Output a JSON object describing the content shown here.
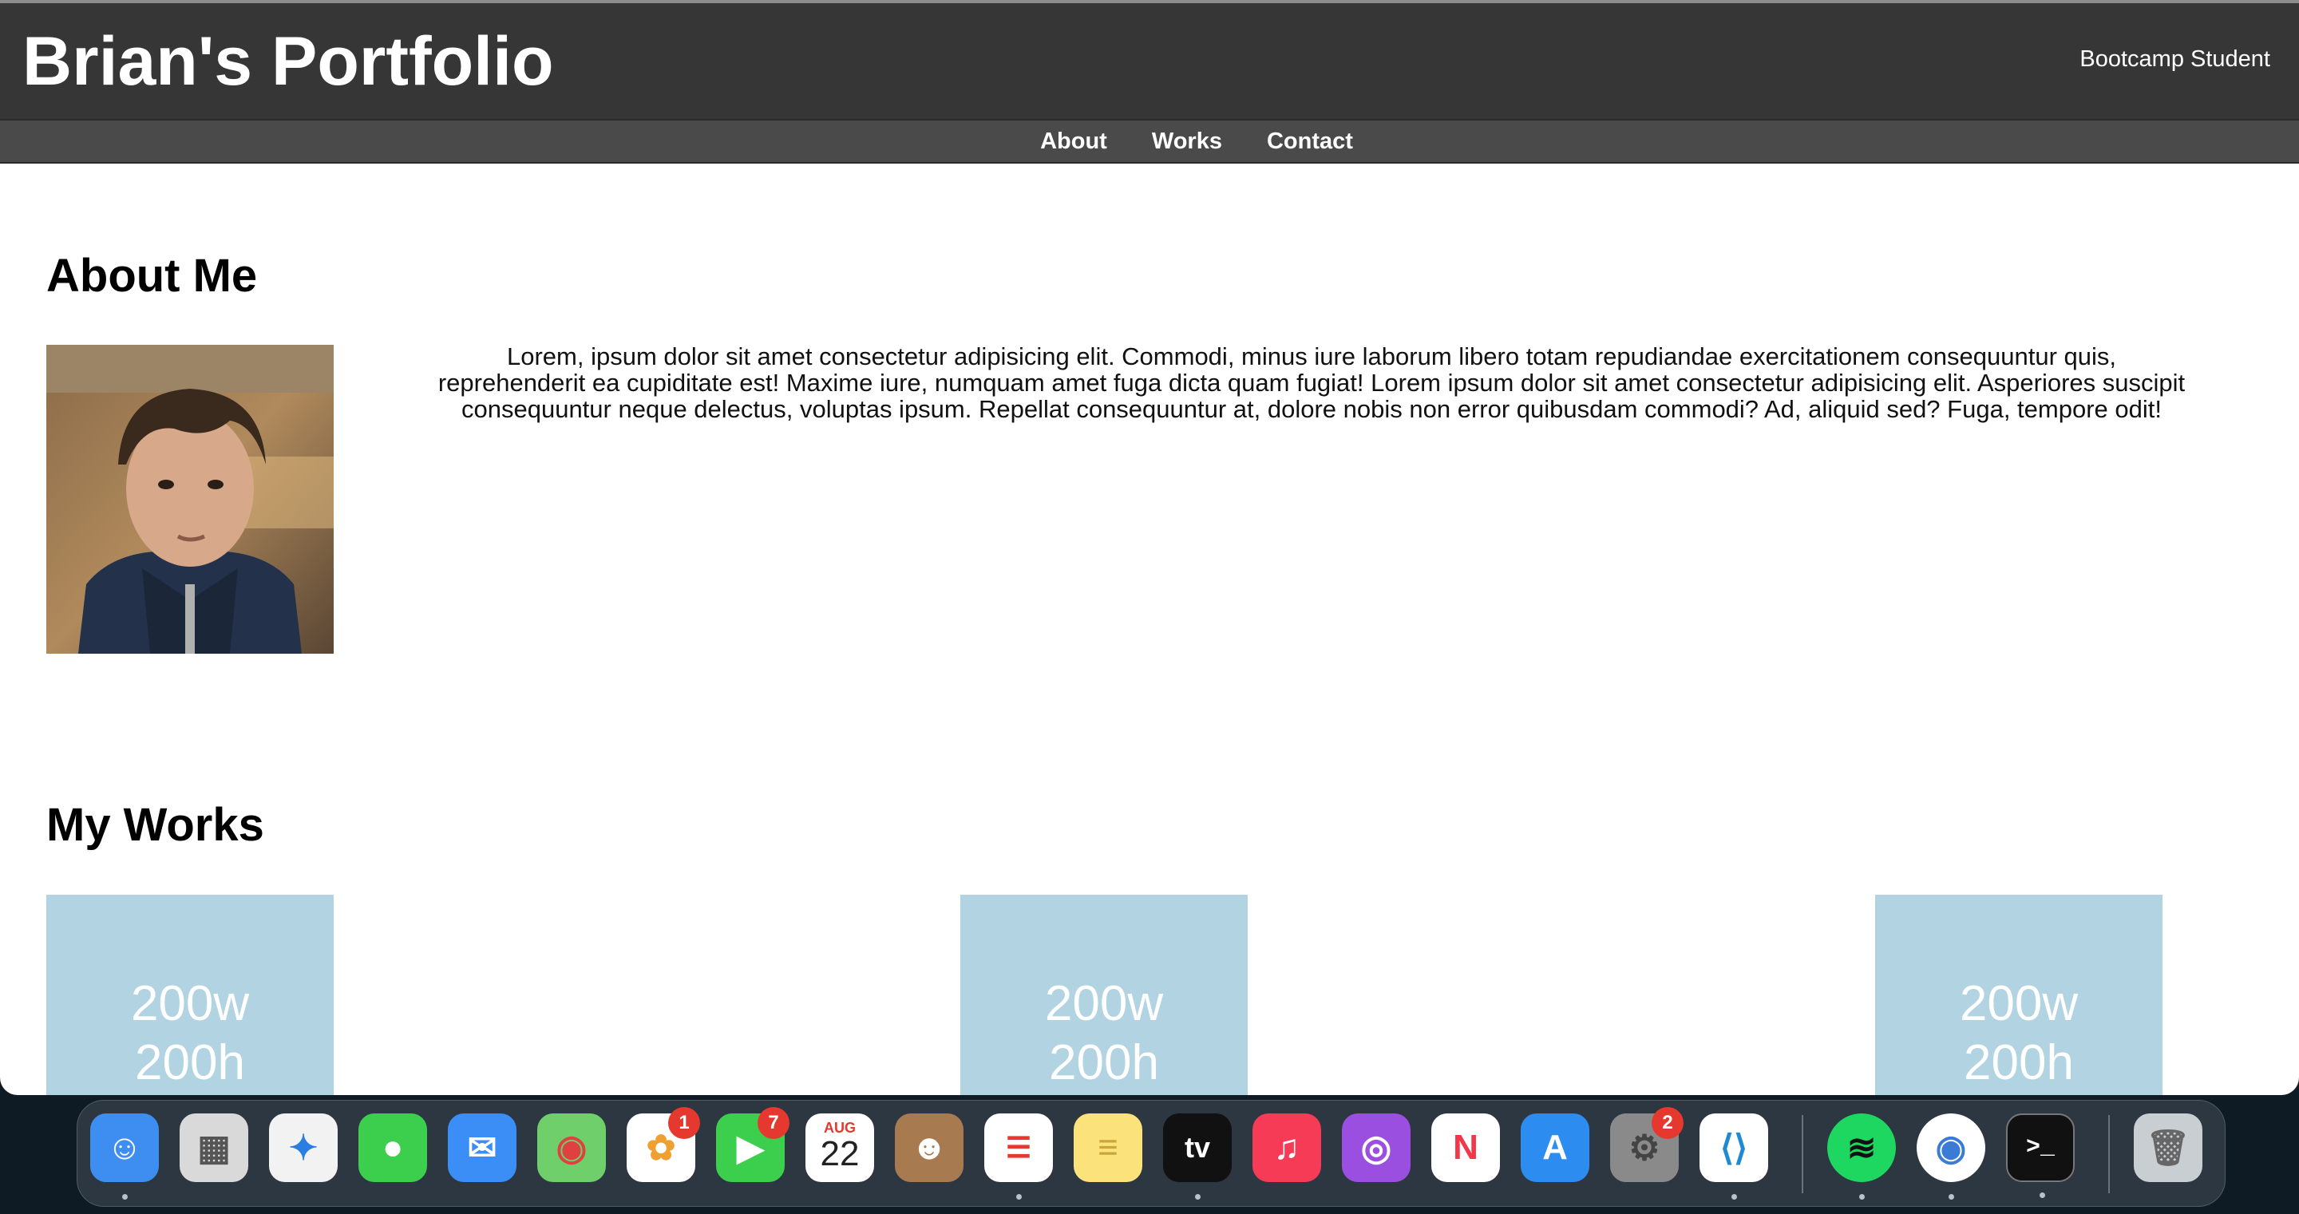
{
  "site": {
    "title": "Brian's Portfolio",
    "subtitle": "Bootcamp Student"
  },
  "nav": {
    "items": [
      "About",
      "Works",
      "Contact"
    ]
  },
  "about": {
    "heading": "About Me",
    "text": "Lorem, ipsum dolor sit amet consectetur adipisicing elit. Commodi, minus iure laborum libero totam repudiandae exercitationem consequuntur quis, reprehenderit ea cupiditate est! Maxime iure, numquam amet fuga dicta quam fugiat! Lorem ipsum dolor sit amet consectetur adipisicing elit. Asperiores suscipit consequuntur neque delectus, voluptas ipsum. Repellat consequuntur at, dolore nobis non error quibusdam commodi? Ad, aliquid sed? Fuga, tempore odit!"
  },
  "works": {
    "heading": "My Works",
    "cards": [
      {
        "line1": "200w",
        "line2": "200h"
      },
      {
        "line1": "200w",
        "line2": "200h"
      },
      {
        "line1": "200w",
        "line2": "200h"
      }
    ]
  },
  "dock": {
    "apps": [
      {
        "name": "finder-icon",
        "color": "#3d8ef0"
      },
      {
        "name": "launchpad-icon",
        "color": "#d9d9d9"
      },
      {
        "name": "safari-icon",
        "color": "#f2f2f2"
      },
      {
        "name": "messages-icon",
        "color": "#3ccf4e"
      },
      {
        "name": "mail-icon",
        "color": "#3a8ef5"
      },
      {
        "name": "maps-icon",
        "color": "#6fcf6a"
      },
      {
        "name": "photos-icon",
        "color": "#ffffff",
        "badge": "1"
      },
      {
        "name": "facetime-icon",
        "color": "#3ccf4e",
        "badge": "7"
      },
      {
        "name": "calendar-icon",
        "color": "#ffffff",
        "month": "AUG",
        "day": "22"
      },
      {
        "name": "contacts-icon",
        "color": "#a77b4f"
      },
      {
        "name": "reminders-icon",
        "color": "#ffffff"
      },
      {
        "name": "notes-icon",
        "color": "#fbe27a"
      },
      {
        "name": "apple-tv-icon",
        "color": "#111111",
        "label": "tv"
      },
      {
        "name": "music-icon",
        "color": "#f53b55"
      },
      {
        "name": "podcasts-icon",
        "color": "#9b4fe0"
      },
      {
        "name": "news-icon",
        "color": "#ffffff"
      },
      {
        "name": "app-store-icon",
        "color": "#2d8cf0"
      },
      {
        "name": "system-settings-icon",
        "color": "#8a8a8a",
        "badge": "2"
      },
      {
        "name": "vscode-icon",
        "color": "#ffffff"
      },
      {
        "name": "spotify-icon",
        "color": "#1ed760"
      },
      {
        "name": "chrome-icon",
        "color": "#ffffff"
      },
      {
        "name": "terminal-icon",
        "color": "#111111"
      },
      {
        "name": "trash-icon",
        "color": "#c9ced2"
      }
    ]
  }
}
